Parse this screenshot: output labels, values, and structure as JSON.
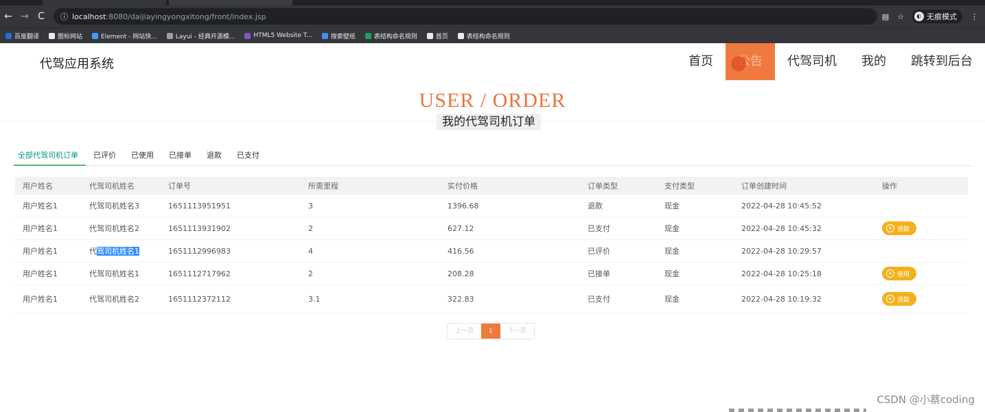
{
  "browser": {
    "nav_icons": [
      "back-icon",
      "forward-icon",
      "reload-icon"
    ],
    "url_host": "localhost",
    "url_rest": ":8080/daijiayingyongxitong/front/index.jsp",
    "incognito_label": "无痕模式",
    "bookmarks": [
      {
        "label": "百度翻译",
        "color": "#2b6ad6"
      },
      {
        "label": "图标网站",
        "color": "#e8eaed"
      },
      {
        "label": "Element - 网站快...",
        "color": "#409eff"
      },
      {
        "label": "Layui - 经典开源模...",
        "color": "#9e9e9e"
      },
      {
        "label": "HTML5 Website T...",
        "color": "#7e57c2"
      },
      {
        "label": "搜索壁纸",
        "color": "#4a8cf0"
      },
      {
        "label": "表结构命名规则",
        "color": "#1aa260"
      },
      {
        "label": "首页",
        "color": "#e8eaed"
      },
      {
        "label": "表结构命名规则",
        "color": "#e8eaed"
      }
    ]
  },
  "header": {
    "brand": "代驾应用系统",
    "nav": [
      {
        "label": "首页",
        "active": false
      },
      {
        "label": "公告",
        "active": true
      },
      {
        "label": "代驾司机",
        "active": false
      },
      {
        "label": "我的",
        "active": false
      },
      {
        "label": "跳转到后台",
        "active": false
      }
    ]
  },
  "section": {
    "title": "USER / ORDER",
    "subtitle": "我的代驾司机订单"
  },
  "tabs": [
    "全部代驾司机订单",
    "已评价",
    "已使用",
    "已接单",
    "退款",
    "已支付"
  ],
  "table": {
    "columns": [
      "用户姓名",
      "代驾司机姓名",
      "订单号",
      "所需里程",
      "实付价格",
      "订单类型",
      "支付类型",
      "订单创建时间",
      "操作"
    ],
    "rows": [
      {
        "user": "用户姓名1",
        "driver": "代驾司机姓名3",
        "order_no": "1651113951951",
        "mileage": "3",
        "price": "1396.68",
        "type": "退款",
        "pay": "现金",
        "created": "2022-04-28 10:45:52",
        "action": ""
      },
      {
        "user": "用户姓名1",
        "driver": "代驾司机姓名2",
        "order_no": "1651113931902",
        "mileage": "2",
        "price": "627.12",
        "type": "已支付",
        "pay": "现金",
        "created": "2022-04-28 10:45:32",
        "action": "退款"
      },
      {
        "user": "用户姓名1",
        "driver_prefix": "代",
        "driver_sel": "驾司机姓名1",
        "order_no": "1651112996983",
        "mileage": "4",
        "price": "416.56",
        "type": "已评价",
        "pay": "现金",
        "created": "2022-04-28 10:29:57",
        "action": ""
      },
      {
        "user": "用户姓名1",
        "driver": "代驾司机姓名1",
        "order_no": "1651112717962",
        "mileage": "2",
        "price": "208.28",
        "type": "已接单",
        "pay": "现金",
        "created": "2022-04-28 10:25:18",
        "action": "使用"
      },
      {
        "user": "用户姓名1",
        "driver": "代驾司机姓名2",
        "order_no": "1651112372112",
        "mileage": "3.1",
        "price": "322.83",
        "type": "已支付",
        "pay": "现金",
        "created": "2022-04-28 10:19:32",
        "action": "退款"
      }
    ]
  },
  "pager": {
    "prev": "上一页",
    "current": "1",
    "next": "下一页"
  },
  "watermark": "CSDN @小蔡coding",
  "colors": {
    "accent": "#f07a3e",
    "title": "#e8743a",
    "button": "#f5b01b",
    "tab_active": "#009688"
  }
}
